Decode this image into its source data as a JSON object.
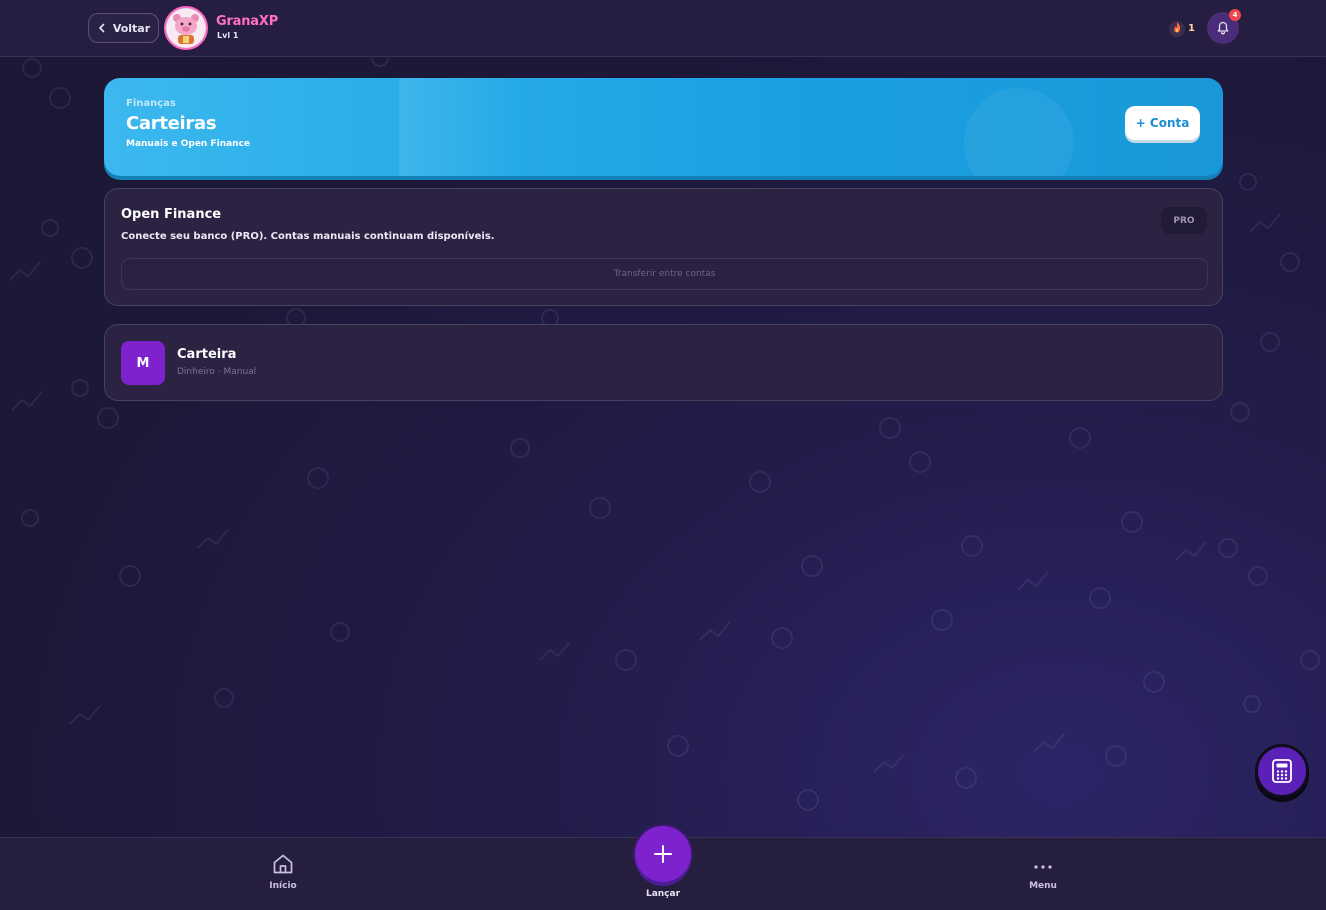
{
  "header": {
    "back_label": "Voltar",
    "app_name": "GranaXP",
    "level": "Lvl 1",
    "streak_count": "1",
    "notification_count": "4"
  },
  "hero": {
    "eyebrow": "Finanças",
    "title": "Carteiras",
    "subtitle": "Manuais e Open Finance",
    "add_button": "+ Conta"
  },
  "open_finance": {
    "title": "Open Finance",
    "description": "Conecte seu banco (PRO). Contas manuais continuam disponíveis.",
    "badge": "PRO",
    "transfer_button": "Transferir entre contas"
  },
  "wallets": [
    {
      "initial": "M",
      "name": "Carteira",
      "meta": "Dinheiro · Manual"
    }
  ],
  "nav": {
    "home_label": "Início",
    "launch_label": "Lançar",
    "menu_label": "Menu"
  },
  "colors": {
    "brand_pink": "#ff6fc8",
    "hero_blue": "#1aa1e2",
    "primary_purple": "#7e22ce",
    "background": "#1d1838"
  }
}
